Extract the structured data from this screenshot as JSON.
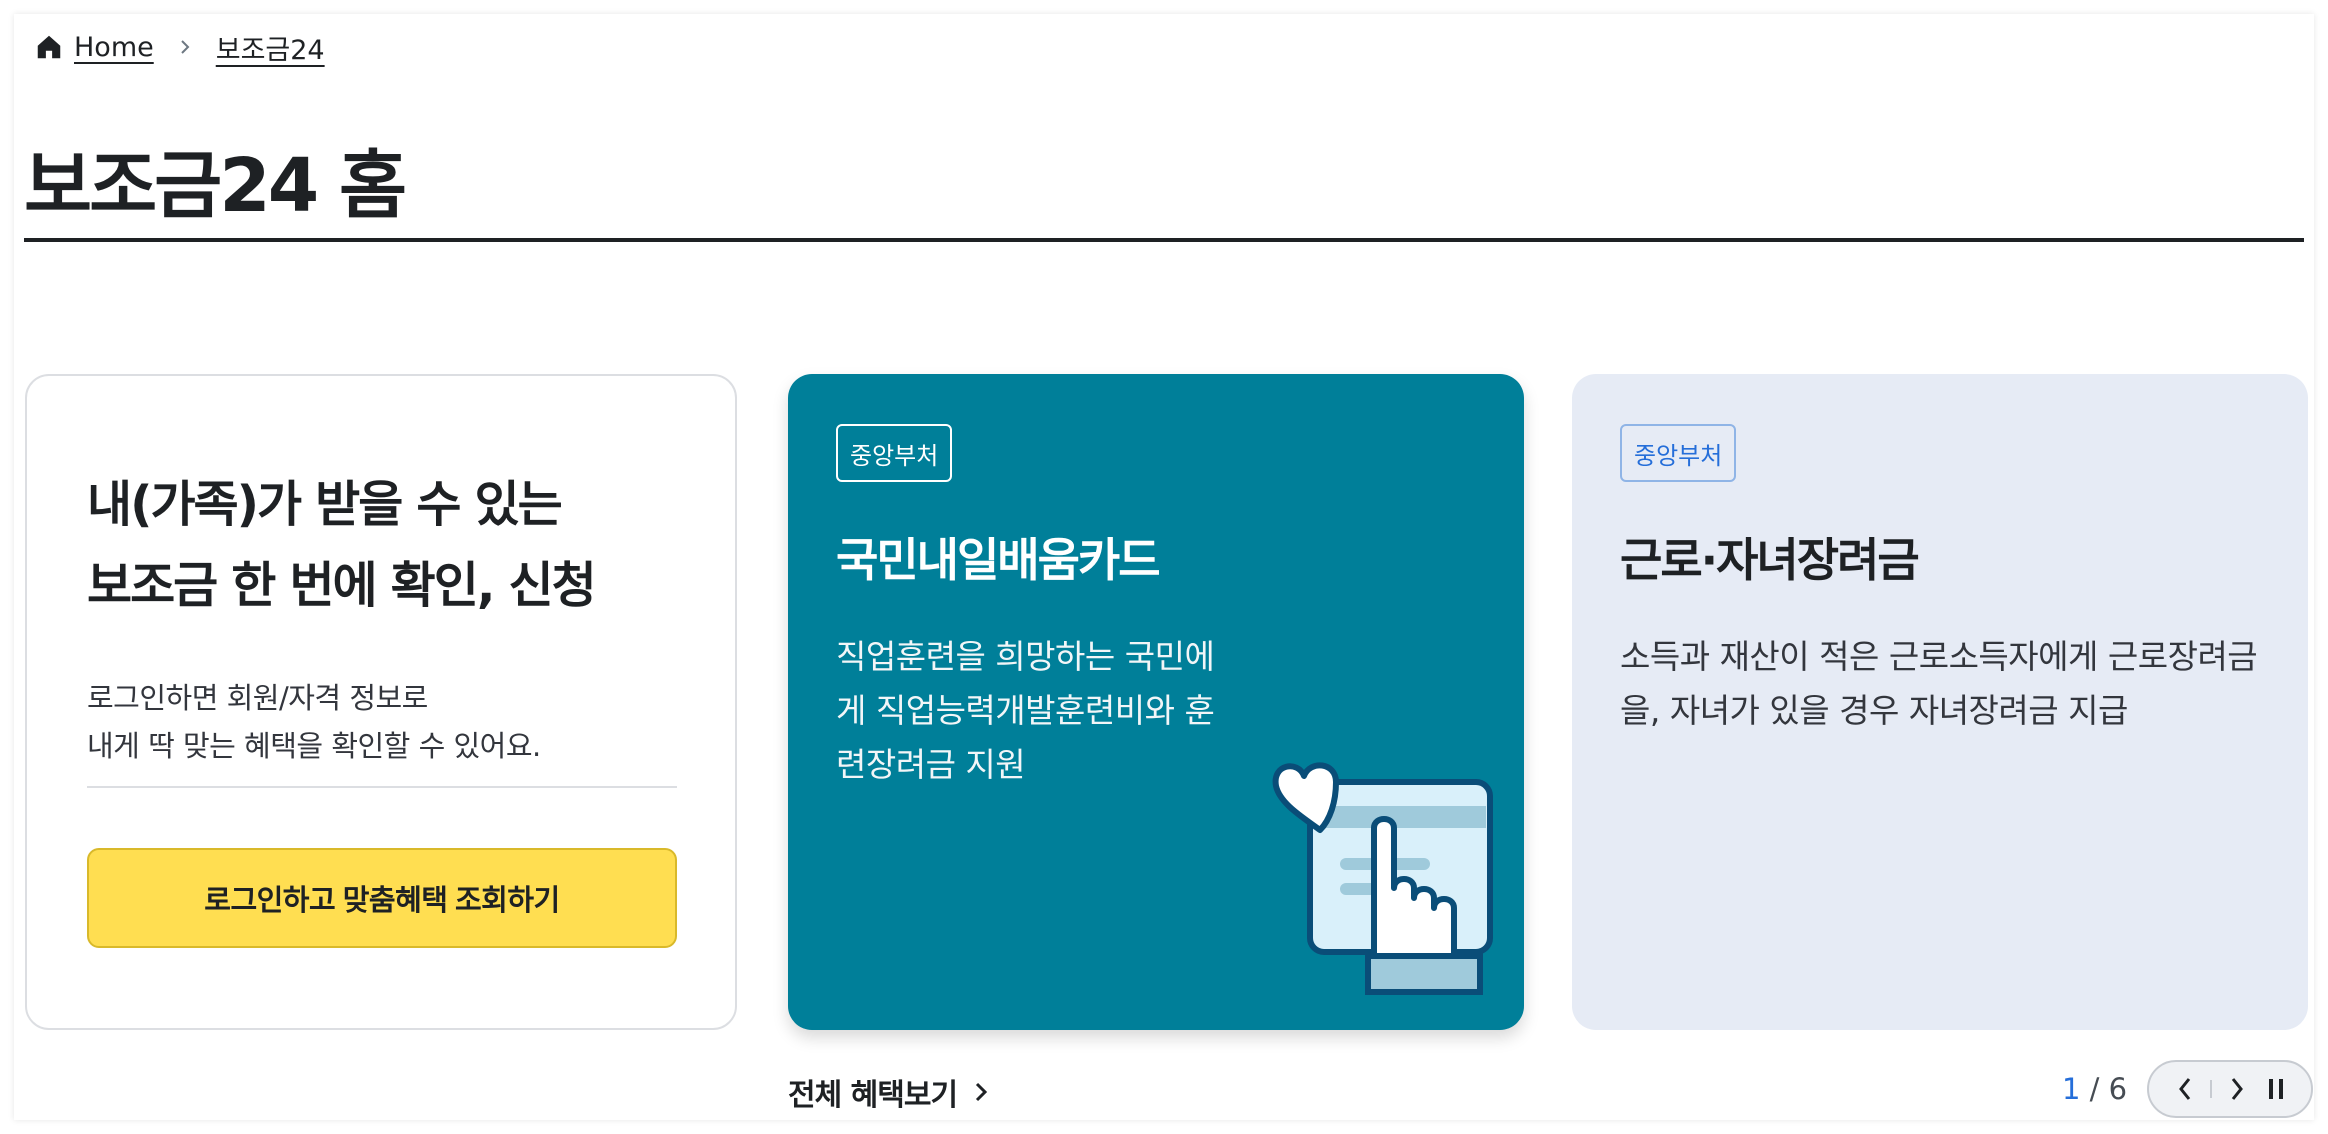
{
  "breadcrumb": {
    "home_label": "Home",
    "current_label": "보조금24"
  },
  "page": {
    "title": "보조금24 홈"
  },
  "login_card": {
    "heading_line1": "내(가족)가 받을 수 있는",
    "heading_line2": "보조금 한 번에 확인, 신청",
    "desc_line1": "로그인하면 회원/자격 정보로",
    "desc_line2": "내게 딱 맞는 혜택을 확인할 수 있어요.",
    "button_label": "로그인하고 맞춤혜택 조회하기"
  },
  "benefits": [
    {
      "tag": "중앙부처",
      "name": "국민내일배움카드",
      "summary": "직업훈련을 희망하는 국민에게 직업능력개발훈련비와 훈련장려금 지원",
      "illustration": "card-hand-heart-illustration",
      "background": "#007f99"
    },
    {
      "tag": "중앙부처",
      "name": "근로·자녀장려금",
      "summary": "소득과 재산이 적은 근로소득자에게 근로장려금을, 자녀가 있을 경우 자녀장려금 지급",
      "background": "#e6ebf5"
    }
  ],
  "footer": {
    "view_all_label": "전체 혜택보기",
    "pager_current": "1",
    "pager_separator": " / ",
    "pager_total": "6"
  },
  "icons": {
    "home": "home-icon",
    "breadcrumb_separator": "chevron-right-icon",
    "prev": "chevron-left-icon",
    "next": "chevron-right-icon",
    "pause": "pause-icon"
  },
  "colors": {
    "accent_button": "#ffde51",
    "teal_card": "#007f99",
    "blue_card": "#e6ebf5",
    "link_blue": "#256ed9"
  }
}
